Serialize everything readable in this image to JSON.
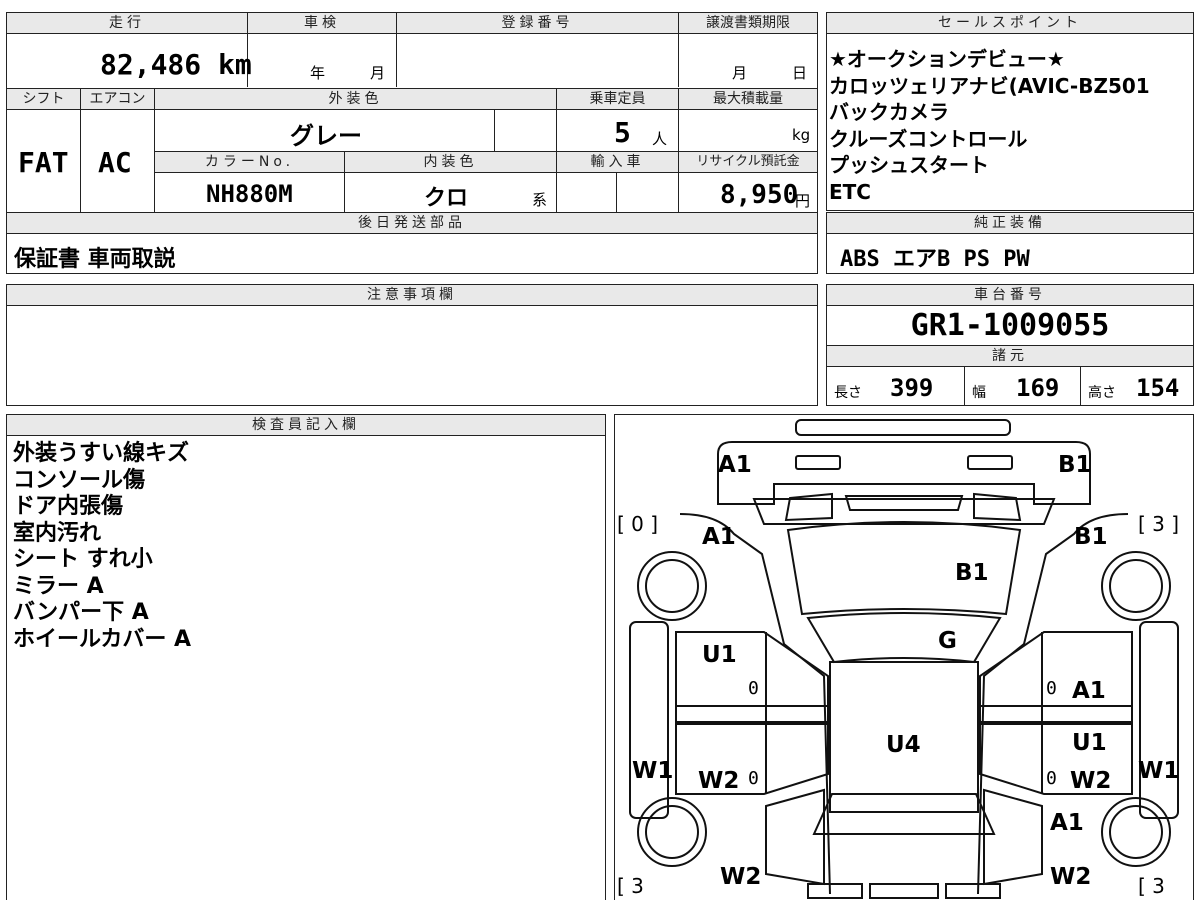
{
  "main": {
    "mileage_label": "走行",
    "mileage_value": "82,486 km",
    "shaken_label": "車検",
    "shaken_year": "年",
    "shaken_month": "月",
    "reg_label": "登録番号",
    "transfer_label": "譲渡書類期限",
    "transfer_month": "月",
    "transfer_day": "日",
    "shift_label": "シフト",
    "shift_value": "FAT",
    "aircon_label": "エアコン",
    "aircon_value": "AC",
    "exterior_label": "外装色",
    "exterior_value": "グレー",
    "capacity_label": "乗車定員",
    "capacity_value": "5",
    "capacity_unit": "人",
    "maxload_label": "最大積載量",
    "maxload_unit": "kg",
    "colorno_label": "カラーNo.",
    "colorno_value": "NH880M",
    "interior_label": "内装色",
    "interior_value": "クロ",
    "interior_suffix": "系",
    "import_label": "輸入車",
    "recycle_label": "リサイクル預託金",
    "recycle_value": "8,950",
    "recycle_unit": "円",
    "later_label": "後日発送部品",
    "later_value": "保証書 車両取説"
  },
  "sales": {
    "label": "セールスポイント",
    "items": [
      "★オークションデビュー★",
      "カロッツェリアナビ(AVIC-BZ501",
      "バックカメラ",
      "クルーズコントロール",
      "プッシュスタート",
      "ETC"
    ]
  },
  "equipment": {
    "label": "純正装備",
    "value": "ABS エアB PS PW"
  },
  "notes": {
    "label": "注意事項欄"
  },
  "chassis": {
    "label": "車台番号",
    "value": "GR1-1009055",
    "spec_label": "諸元",
    "length_label": "長さ",
    "length_value": "399",
    "width_label": "幅",
    "width_value": "169",
    "height_label": "高さ",
    "height_value": "154"
  },
  "inspector": {
    "label": "検査員記入欄",
    "items": [
      "外装うすい線キズ",
      "コンソール傷",
      "ドア内張傷",
      "室内汚れ",
      "シート すれ小",
      "ミラー A",
      "バンパー下 A",
      "ホイールカバー A"
    ]
  },
  "diagram": {
    "labels": {
      "a1_front_left": "A1",
      "b1_front_right": "B1",
      "a1_left_fender": "A1",
      "b1_right_fender": "B1",
      "b1_hood": "B1",
      "g_windshield": "G",
      "u1_left_door": "U1",
      "a1_right_door": "A1",
      "u4_roof": "U4",
      "u1_right_rear_door": "U1",
      "w1_left": "W1",
      "w1_right": "W1",
      "w2_left_rear_door": "W2",
      "w2_right_rear_door": "W2",
      "a1_right_quarter": "A1",
      "w2_left_bottom": "W2",
      "w2_right_bottom": "W2",
      "tire_front_left": "[ 0 ]",
      "tire_front_right": "[ 3 ]",
      "tire_rear_left": "[ 3",
      "tire_rear_right": "[ 3",
      "zero_1": "0",
      "zero_2": "0",
      "zero_3": "0",
      "zero_4": "0"
    }
  }
}
